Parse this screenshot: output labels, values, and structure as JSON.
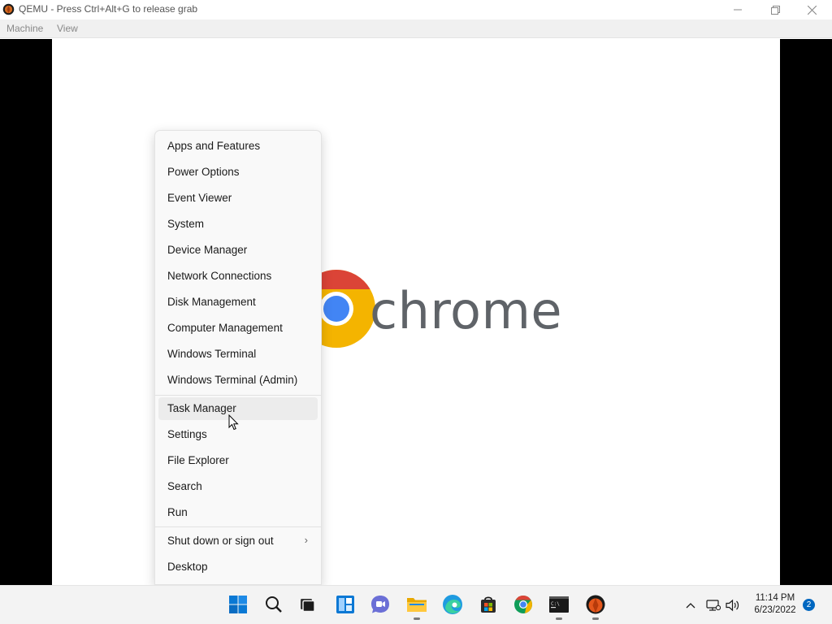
{
  "window": {
    "title": "QEMU - Press Ctrl+Alt+G to release grab",
    "menu": [
      "Machine",
      "View"
    ]
  },
  "desktop": {
    "wordmark": "chrome"
  },
  "context_menu": {
    "group1": [
      "Apps and Features",
      "Power Options",
      "Event Viewer",
      "System",
      "Device Manager",
      "Network Connections",
      "Disk Management",
      "Computer Management",
      "Windows Terminal",
      "Windows Terminal (Admin)"
    ],
    "group2": [
      "Task Manager",
      "Settings",
      "File Explorer",
      "Search",
      "Run"
    ],
    "group3": [
      "Shut down or sign out",
      "Desktop"
    ],
    "hovered": "Task Manager"
  },
  "taskbar": {
    "pinned": [
      "windows-start",
      "search",
      "task-view",
      "widgets",
      "chat",
      "file-explorer",
      "edge",
      "store",
      "chrome",
      "terminal",
      "qemu"
    ],
    "clock_time": "11:14 PM",
    "clock_date": "6/23/2022",
    "notification_count": "2"
  },
  "colors": {
    "accent": "#0067c0",
    "start_blue": "#0a78d4",
    "chrome_red": "#db4437",
    "chrome_yellow": "#f4b400",
    "chrome_blue": "#4285f4"
  }
}
